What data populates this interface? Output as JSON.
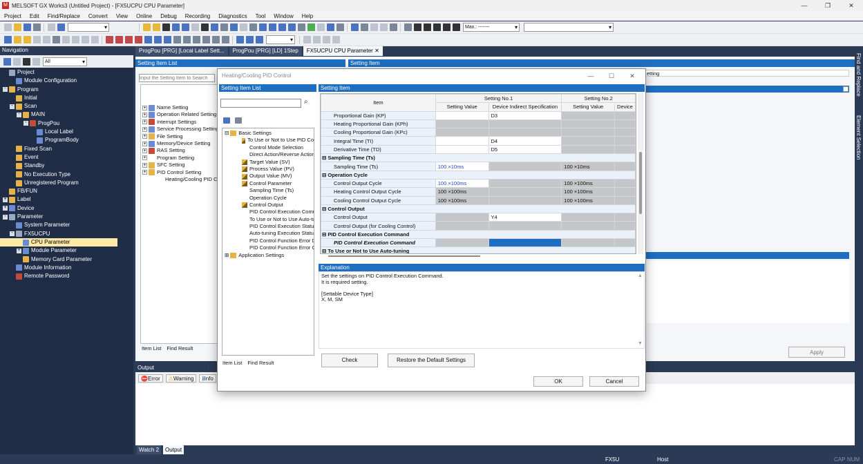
{
  "app": {
    "title": "MELSOFT GX Works3 (Untitled Project) - [FX5UCPU CPU Parameter]",
    "window_controls": [
      "—",
      "❐",
      "✕"
    ]
  },
  "menu": [
    "Project",
    "Edit",
    "Find/Replace",
    "Convert",
    "View",
    "Online",
    "Debug",
    "Recording",
    "Diagnostics",
    "Tool",
    "Window",
    "Help"
  ],
  "toolbar": {
    "monitor_combo": "Max.: -------"
  },
  "navigation": {
    "title": "Navigation",
    "filter": "All",
    "tree": [
      {
        "label": "Project",
        "level": 0,
        "exp": "",
        "ic": "p"
      },
      {
        "label": "Module Configuration",
        "level": 1,
        "exp": "",
        "ic": "s"
      },
      {
        "label": "Program",
        "level": 0,
        "exp": "-",
        "ic": "f"
      },
      {
        "label": "Initial",
        "level": 1,
        "exp": "",
        "ic": "f"
      },
      {
        "label": "Scan",
        "level": 1,
        "exp": "-",
        "ic": "f"
      },
      {
        "label": "MAIN",
        "level": 2,
        "exp": "-",
        "ic": "f"
      },
      {
        "label": "ProgPou",
        "level": 3,
        "exp": "-",
        "ic": "c"
      },
      {
        "label": "Local Label",
        "level": 4,
        "exp": "",
        "ic": "s"
      },
      {
        "label": "ProgramBody",
        "level": 4,
        "exp": "",
        "ic": "s"
      },
      {
        "label": "Fixed Scan",
        "level": 1,
        "exp": "",
        "ic": "f"
      },
      {
        "label": "Event",
        "level": 1,
        "exp": "",
        "ic": "f"
      },
      {
        "label": "Standby",
        "level": 1,
        "exp": "",
        "ic": "f"
      },
      {
        "label": "No Execution Type",
        "level": 1,
        "exp": "",
        "ic": "f"
      },
      {
        "label": "Unregistered Program",
        "level": 1,
        "exp": "",
        "ic": "f"
      },
      {
        "label": "FB/FUN",
        "level": 0,
        "exp": "",
        "ic": "f"
      },
      {
        "label": "Label",
        "level": 0,
        "exp": "+",
        "ic": "f"
      },
      {
        "label": "Device",
        "level": 0,
        "exp": "+",
        "ic": "s"
      },
      {
        "label": "Parameter",
        "level": 0,
        "exp": "-",
        "ic": "p"
      },
      {
        "label": "System Parameter",
        "level": 1,
        "exp": "",
        "ic": "s"
      },
      {
        "label": "FX5UCPU",
        "level": 1,
        "exp": "-",
        "ic": "p"
      },
      {
        "label": "CPU Parameter",
        "level": 2,
        "exp": "",
        "ic": "s",
        "selected": true
      },
      {
        "label": "Module Parameter",
        "level": 2,
        "exp": "+",
        "ic": "s"
      },
      {
        "label": "Memory Card Parameter",
        "level": 2,
        "exp": "",
        "ic": "f"
      },
      {
        "label": "Module Information",
        "level": 1,
        "exp": "",
        "ic": "s"
      },
      {
        "label": "Remote Password",
        "level": 1,
        "exp": "",
        "ic": "c"
      }
    ]
  },
  "tabs": [
    "ProgPou [PRG] [Local Label Sett...",
    "ProgPou [PRG] [LD] 1Step",
    "FX5UCPU CPU Parameter"
  ],
  "side_panels": [
    "Find and Replace",
    "Element Selection"
  ],
  "cpu_param": {
    "item_list_header": "Setting Item List",
    "setting_item_header": "Setting Item",
    "search_placeholder": "Input the Setting Item to Search",
    "setting_label": "etting",
    "items": [
      "Name Setting",
      "Operation Related Setting",
      "Interrupt Settings",
      "Service Processing Setting",
      "File Setting",
      "Memory/Device Setting",
      "RAS Setting",
      "Program Setting",
      "SFC Setting",
      "PID Control Setting",
      "Heating/Cooling PID C"
    ],
    "tab_item_list": "Item List",
    "tab_find_result": "Find Result",
    "apply": "Apply"
  },
  "output": {
    "title": "Output",
    "buttons": [
      "Error",
      "Warning",
      "Info"
    ],
    "bottom_tabs": [
      "Watch 2",
      "Output"
    ]
  },
  "status": {
    "model": "FX5U",
    "conn": "Host",
    "caps": "CAP",
    "num": "NUM"
  },
  "dialog": {
    "title": "Heating/Cooling PID Control",
    "left_header": "Setting Item List",
    "right_header": "Setting Item",
    "tree": [
      {
        "label": "Basic Settings",
        "type": "group"
      },
      {
        "label": "To Use or Not to Use PID Co",
        "type": "pen"
      },
      {
        "label": "Control Mode Selection",
        "type": "plain"
      },
      {
        "label": "Direct Action/Reverse Action",
        "type": "plain"
      },
      {
        "label": "Target Value (SV)",
        "type": "pen"
      },
      {
        "label": "Process Value (PV)",
        "type": "pen"
      },
      {
        "label": "Output Value (MV)",
        "type": "pen"
      },
      {
        "label": "Control Parameter",
        "type": "pen"
      },
      {
        "label": "Sampling Time (Ts)",
        "type": "plain"
      },
      {
        "label": "Operation Cycle",
        "type": "plain"
      },
      {
        "label": "Control Output",
        "type": "pen"
      },
      {
        "label": "PID Control Execution Comma",
        "type": "plain"
      },
      {
        "label": "To Use or Not to Use Auto-tu",
        "type": "plain"
      },
      {
        "label": "PID Control Execution Status",
        "type": "plain"
      },
      {
        "label": "Auto-tuning Execution Status",
        "type": "plain"
      },
      {
        "label": "PID Control Function Error Di",
        "type": "plain"
      },
      {
        "label": "PID Control Function Error Co",
        "type": "plain"
      },
      {
        "label": "Application Settings",
        "type": "group2"
      }
    ],
    "tab_item_list": "Item List",
    "tab_find_result": "Find Result",
    "grid_headers": {
      "item": "Item",
      "no1": "Setting No.1",
      "no2": "Setting No.2",
      "setting_value": "Setting Value",
      "indirect": "Device Indirect Specification",
      "setting_value2": "Setting Value",
      "device2": "Device"
    },
    "rows": [
      {
        "type": "item",
        "label": "Proportional Gain (KP)",
        "v1": "",
        "d1": "D3",
        "v2": "",
        "c": [
          "wh",
          "wh",
          "gy",
          "gy"
        ]
      },
      {
        "type": "item",
        "label": "Heating Proportional Gain (KPh)",
        "v1": "",
        "d1": "",
        "v2": "",
        "c": [
          "gy",
          "gy",
          "gy",
          "gy"
        ]
      },
      {
        "type": "item",
        "label": "Cooling Proportional Gain (KPc)",
        "v1": "",
        "d1": "",
        "v2": "",
        "c": [
          "gy",
          "gy",
          "gy",
          "gy"
        ]
      },
      {
        "type": "item",
        "label": "Integral Time (TI)",
        "v1": "",
        "d1": "D4",
        "v2": "",
        "c": [
          "wh",
          "wh",
          "gy",
          "gy"
        ]
      },
      {
        "type": "item",
        "label": "Derivative Time (TD)",
        "v1": "",
        "d1": "D5",
        "v2": "",
        "c": [
          "wh",
          "wh",
          "gy",
          "gy"
        ]
      },
      {
        "type": "section",
        "label": "Sampling Time (Ts)"
      },
      {
        "type": "item",
        "label": "Sampling Time (Ts)",
        "v1": "100 ×10ms",
        "d1": "",
        "v2": "100 ×10ms",
        "c": [
          "wh blu",
          "gy",
          "gy",
          "gy"
        ]
      },
      {
        "type": "section",
        "label": "Operation Cycle"
      },
      {
        "type": "item",
        "label": "Control Output Cycle",
        "v1": "100 ×100ms",
        "d1": "",
        "v2": "100 ×100ms",
        "c": [
          "wh blu",
          "gy",
          "gy",
          "gy"
        ]
      },
      {
        "type": "item",
        "label": "Heating Control Output Cycle",
        "v1": "100 ×100ms",
        "d1": "",
        "v2": "100 ×100ms",
        "c": [
          "gy",
          "gy",
          "gy",
          "gy"
        ]
      },
      {
        "type": "item",
        "label": "Cooling Control Output Cycle",
        "v1": "100 ×100ms",
        "d1": "",
        "v2": "100 ×100ms",
        "c": [
          "gy",
          "gy",
          "gy",
          "gy"
        ]
      },
      {
        "type": "section",
        "label": "Control Output"
      },
      {
        "type": "item",
        "label": "Control Output",
        "v1": "",
        "d1": "Y4",
        "v2": "",
        "c": [
          "gy",
          "wh",
          "gy",
          "gy"
        ]
      },
      {
        "type": "item",
        "label": "Control Output (for Cooling Control)",
        "v1": "",
        "d1": "",
        "v2": "",
        "c": [
          "gy",
          "gy",
          "gy",
          "gy"
        ]
      },
      {
        "type": "section",
        "label": "PID Control Execution Command"
      },
      {
        "type": "itemsel",
        "label": "PID Control Execution Command",
        "v1": "",
        "d1": "",
        "v2": "",
        "c": [
          "gy",
          "sel",
          "gy",
          "gy"
        ]
      },
      {
        "type": "section",
        "label": "To Use or Not to Use Auto-tuning"
      }
    ],
    "explanation_header": "Explanation",
    "explanation": [
      "Set the settings on PID Control Execution Command.",
      "It is required setting.",
      "",
      "[Settable Device Type]",
      "X, M, SM"
    ],
    "buttons": {
      "check": "Check",
      "restore": "Restore the Default Settings",
      "ok": "OK",
      "cancel": "Cancel"
    }
  }
}
